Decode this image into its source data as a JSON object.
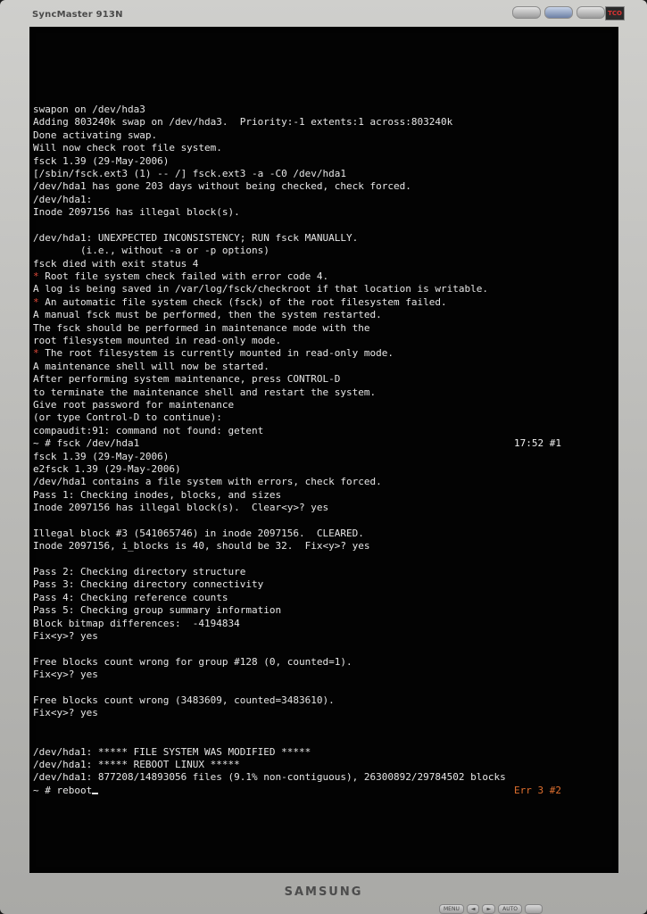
{
  "monitor": {
    "model_label": "SyncMaster 913N",
    "brand_label": "SAMSUNG",
    "controls": [
      {
        "label": "MENU"
      },
      {
        "label": "◄"
      },
      {
        "label": "►"
      },
      {
        "label": "AUTO"
      },
      {
        "label": ""
      }
    ]
  },
  "terminal": {
    "lines": [
      "swapon on /dev/hda3",
      "Adding 803240k swap on /dev/hda3.  Priority:-1 extents:1 across:803240k",
      "Done activating swap.",
      "Will now check root file system.",
      "fsck 1.39 (29-May-2006)",
      "[/sbin/fsck.ext3 (1) -- /] fsck.ext3 -a -C0 /dev/hda1",
      "/dev/hda1 has gone 203 days without being checked, check forced.",
      "/dev/hda1:",
      "Inode 2097156 has illegal block(s).",
      "",
      "/dev/hda1: UNEXPECTED INCONSISTENCY; RUN fsck MANUALLY.",
      "        (i.e., without -a or -p options)",
      "fsck died with exit status 4",
      "* Root file system check failed with error code 4.",
      "A log is being saved in /var/log/fsck/checkroot if that location is writable.",
      "* An automatic file system check (fsck) of the root filesystem failed.",
      "A manual fsck must be performed, then the system restarted.",
      "The fsck should be performed in maintenance mode with the",
      "root filesystem mounted in read-only mode.",
      "* The root filesystem is currently mounted in read-only mode.",
      "A maintenance shell will now be started.",
      "After performing system maintenance, press CONTROL-D",
      "to terminate the maintenance shell and restart the system.",
      "Give root password for maintenance",
      "(or type Control-D to continue):",
      "compaudit:91: command not found: getent",
      "~ # fsck /dev/hda1",
      "fsck 1.39 (29-May-2006)",
      "e2fsck 1.39 (29-May-2006)",
      "/dev/hda1 contains a file system with errors, check forced.",
      "Pass 1: Checking inodes, blocks, and sizes",
      "Inode 2097156 has illegal block(s).  Clear<y>? yes",
      "",
      "Illegal block #3 (541065746) in inode 2097156.  CLEARED.",
      "Inode 2097156, i_blocks is 40, should be 32.  Fix<y>? yes",
      "",
      "Pass 2: Checking directory structure",
      "Pass 3: Checking directory connectivity",
      "Pass 4: Checking reference counts",
      "Pass 5: Checking group summary information",
      "Block bitmap differences:  -4194834",
      "Fix<y>? yes",
      "",
      "Free blocks count wrong for group #128 (0, counted=1).",
      "Fix<y>? yes",
      "",
      "Free blocks count wrong (3483609, counted=3483610).",
      "Fix<y>? yes",
      "",
      "",
      "/dev/hda1: ***** FILE SYSTEM WAS MODIFIED *****",
      "/dev/hda1: ***** REBOOT LINUX *****",
      "/dev/hda1: 877208/14893056 files (9.1% non-contiguous), 26300892/29784502 blocks",
      "~ # reboot"
    ],
    "status_1": "17:52 #1",
    "status_2": "Err 3 #2"
  }
}
